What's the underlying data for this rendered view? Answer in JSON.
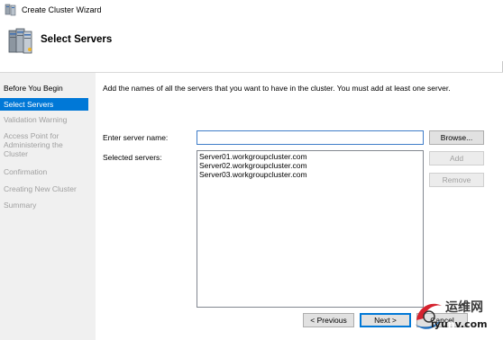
{
  "window": {
    "title": "Create Cluster Wizard"
  },
  "header": {
    "title": "Select Servers"
  },
  "sidebar": {
    "items": [
      {
        "label": "Before You Begin",
        "state": "done"
      },
      {
        "label": "Select Servers",
        "state": "current"
      },
      {
        "label": "Validation Warning",
        "state": "pending"
      },
      {
        "label": "Access Point for Administering the Cluster",
        "state": "pending"
      },
      {
        "label": "Confirmation",
        "state": "pending"
      },
      {
        "label": "Creating New Cluster",
        "state": "pending"
      },
      {
        "label": "Summary",
        "state": "pending"
      }
    ]
  },
  "main": {
    "instruction": "Add the names of all the servers that you want to have in the cluster. You must add at least one server.",
    "server_name_label": "Enter server name:",
    "server_name_value": "",
    "selected_servers_label": "Selected servers:",
    "selected_servers": [
      "Server01.workgroupcluster.com",
      "Server02.workgroupcluster.com",
      "Server03.workgroupcluster.com"
    ],
    "browse_label": "Browse...",
    "add_label": "Add",
    "remove_label": "Remove"
  },
  "footer": {
    "previous_label": "< Previous",
    "next_label": "Next >",
    "cancel_label": "Cancel"
  },
  "watermark": {
    "logo_text": "运维网",
    "url_prefix": "iyu",
    "url_highlight": "n",
    "url_suffix": "v.com"
  },
  "colors": {
    "accent": "#0078d7",
    "sidebar_bg": "#f0f0f0",
    "disabled_text": "#a0a0a0"
  }
}
